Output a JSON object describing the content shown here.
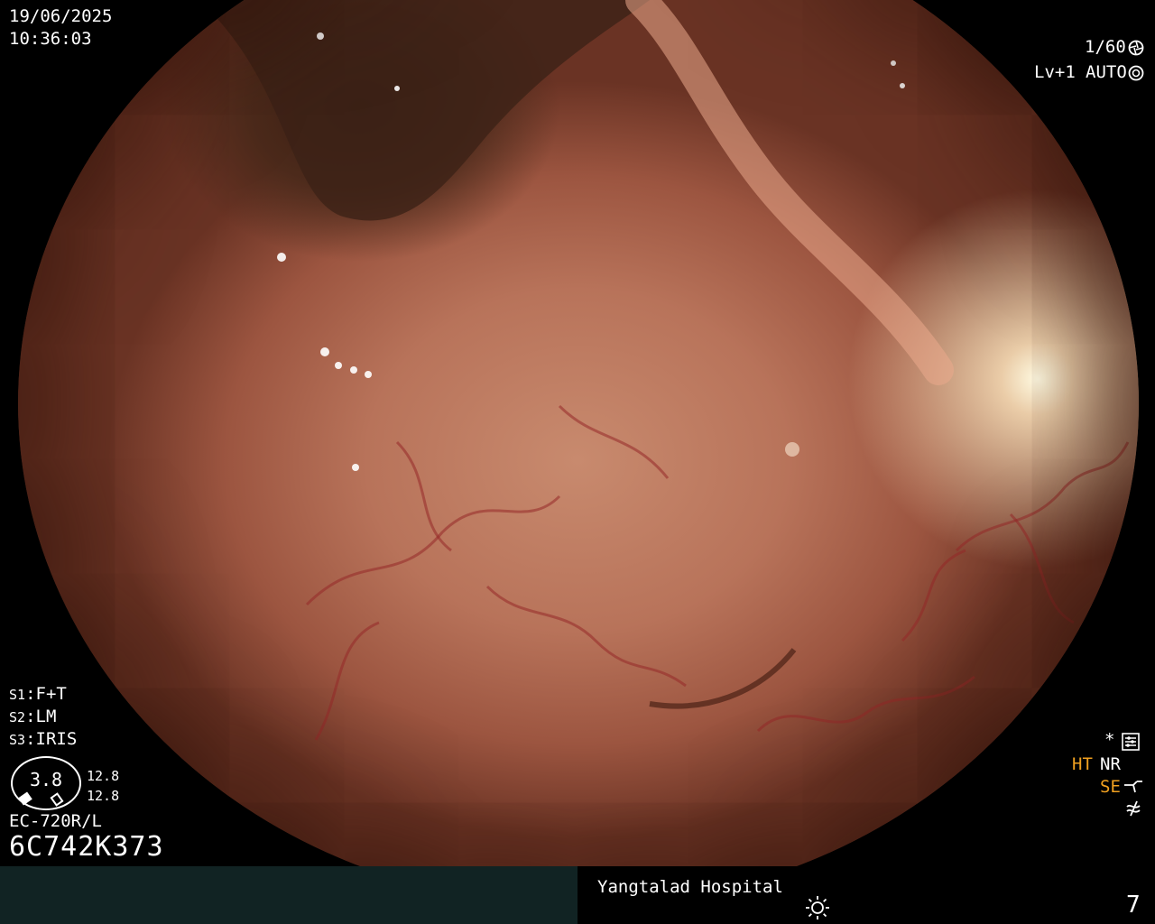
{
  "overlay": {
    "date": "19/06/2025",
    "time": "10:36:03",
    "shutter": "1/60",
    "level": "Lv+1",
    "iris_mode": "AUTO",
    "s1_label": "S1",
    "s1_value": "F+T",
    "s2_label": "S2",
    "s2_value": "LM",
    "s3_label": "S3",
    "s3_value": "IRIS",
    "scope_value": "3.8",
    "scope_upper": "12.8",
    "scope_lower": "12.8",
    "model": "EC-720R/L",
    "serial": "6C742K373",
    "star": "*",
    "ht": "HT",
    "nr": "NR",
    "se": "SE",
    "hospital": "Yangtalad Hospital",
    "image_number": "7"
  },
  "colors": {
    "orange_indicator": "#f0a020",
    "bottom_bar": "#112323"
  },
  "icons": [
    "aperture-icon",
    "iris-icon",
    "settings-icon",
    "enhance-icon",
    "freeze-icon",
    "brightness-icon"
  ]
}
